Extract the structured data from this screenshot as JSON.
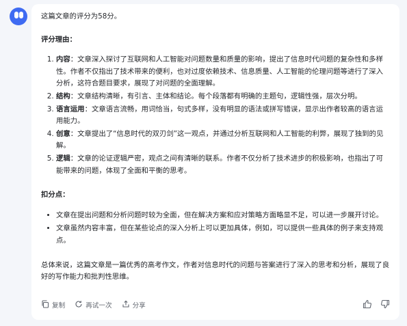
{
  "message": {
    "intro": "这篇文章的评分为58分。",
    "reasons_title": "评分理由：",
    "reasons": [
      {
        "term": "内容",
        "text": "：文章深入探讨了互联网和人工智能对问题数量和质量的影响，提出了信息时代问题的复杂性和多样性。作者不仅指出了技术带来的便利，也对过度依赖技术、信息质量、人工智能的伦理问题等进行了深入分析，这符合题目要求，展现了对问题的全面理解。"
      },
      {
        "term": "结构",
        "text": "：文章结构清晰，有引言、主体和结论。每个段落都有明确的主题句，逻辑性强，层次分明。"
      },
      {
        "term": "语言运用",
        "text": "：文章语言流畅，用词恰当，句式多样，没有明显的语法或拼写错误，显示出作者较高的语言运用能力。"
      },
      {
        "term": "创意",
        "text": "：文章提出了“信息时代的双刃剑”这一观点，并通过分析互联网和人工智能的利弊，展现了独到的见解。"
      },
      {
        "term": "逻辑",
        "text": "：文章的论证逻辑严密，观点之间有清晰的联系。作者不仅分析了技术进步的积极影响，也指出了可能带来的问题，体现了全面和平衡的思考。"
      }
    ],
    "deductions_title": "扣分点：",
    "deductions": [
      "文章在提出问题和分析问题时较为全面，但在解决方案和应对策略方面略显不足，可以进一步展开讨论。",
      "文章虽然内容丰富，但在某些论点的深入分析上可以更加具体，例如，可以提供一些具体的例子来支持观点。"
    ],
    "summary": "总体来说，这篇文章是一篇优秀的高考作文，作者对信息时代的问题与答案进行了深入的思考和分析，展现了良好的写作能力和批判性思维。"
  },
  "actions": {
    "copy_label": "复制",
    "retry_label": "再试一次",
    "share_label": "分享"
  },
  "icons": {
    "avatar": "assistant-avatar",
    "copy": "copy-icon",
    "retry": "refresh-icon",
    "share": "share-icon",
    "like": "thumbs-up-icon",
    "dislike": "thumbs-down-icon"
  },
  "colors": {
    "avatar": "#3f6bf2",
    "background": "#f4f6fa",
    "card": "#ffffff"
  }
}
